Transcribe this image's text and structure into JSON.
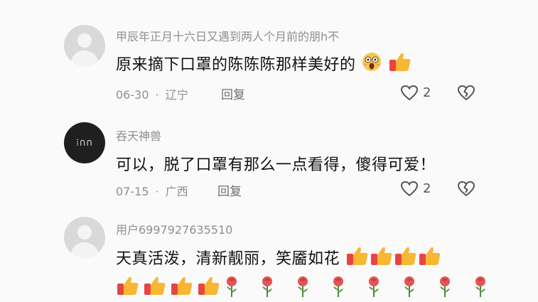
{
  "comments": [
    {
      "username": "甲辰年正月十六日又遇到两人个月前的朋h不",
      "text": "原来摘下口罩的陈陈陈那样美好的",
      "date": "06-30",
      "location": "辽宁",
      "reply_label": "回复",
      "likes": "2",
      "emojis": [
        "astonished-face",
        "thumbs-up"
      ]
    },
    {
      "username": "吞天神兽",
      "text": "可以，脱了口罩有那么一点看得，傻得可爱！",
      "date": "07-15",
      "location": "广西",
      "reply_label": "回复",
      "likes": "2"
    },
    {
      "username": "用户6997927635510",
      "text": "天真活泼，清新靓丽，笑靥如花",
      "emojis_line1": [
        "thumbs-up",
        "thumbs-up",
        "thumbs-up",
        "thumbs-up"
      ],
      "emojis_line2": [
        "thumbs-up",
        "thumbs-up",
        "thumbs-up",
        "thumbs-up",
        "rose",
        "rose",
        "rose",
        "rose",
        "rose",
        "rose",
        "rose",
        "rose"
      ]
    }
  ],
  "separator": "·",
  "colors": {
    "text_primary": "#111111",
    "text_secondary": "#8f8f8f",
    "icon_gray": "#555555",
    "thumb_yellow": "#f7b733",
    "sleeve_red": "#e64545",
    "rose_red": "#e25555"
  }
}
